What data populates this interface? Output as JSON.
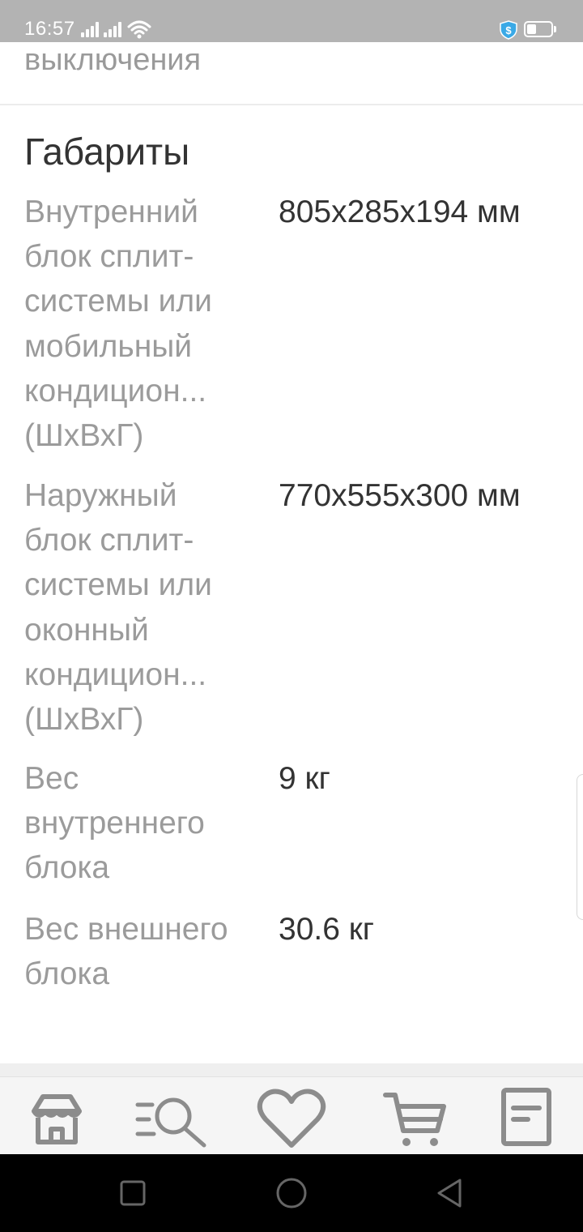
{
  "status_bar": {
    "time": "16:57"
  },
  "previous_section": {
    "tail_text": "выключения"
  },
  "dimensions_section": {
    "title": "Габариты",
    "rows": [
      {
        "label": "Внутренний блок сплит-системы или мобильный кондицион... (ШхВхГ)",
        "value": "805x285x194 мм"
      },
      {
        "label": "Наружный блок сплит-системы или оконный кондицион... (ШхВхГ)",
        "value": "770x555x300 мм"
      },
      {
        "label": "Вес внутреннего блока",
        "value": "9 кг"
      },
      {
        "label": "Вес внешнего блока",
        "value": "30.6 кг"
      }
    ]
  },
  "tab_bar": {
    "tabs": [
      {
        "icon": "store-icon"
      },
      {
        "icon": "catalog-search-icon"
      },
      {
        "icon": "heart-icon"
      },
      {
        "icon": "cart-icon"
      },
      {
        "icon": "orders-icon"
      }
    ]
  },
  "colors": {
    "label_gray": "#9b9b9b",
    "value_dark": "#333333",
    "status_bar": "#b3b3b3",
    "icon_gray": "#8c8c8c",
    "shield_blue": "#3aa9e6"
  }
}
